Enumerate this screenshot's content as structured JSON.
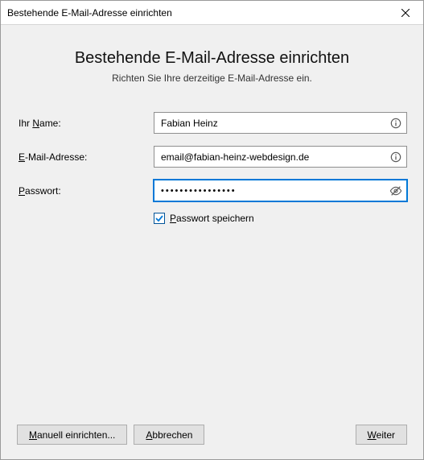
{
  "window": {
    "title": "Bestehende E-Mail-Adresse einrichten"
  },
  "header": {
    "title": "Bestehende E-Mail-Adresse einrichten",
    "subtitle": "Richten Sie Ihre derzeitige E-Mail-Adresse ein."
  },
  "form": {
    "name": {
      "label_pre": "Ihr ",
      "label_access": "N",
      "label_post": "ame:",
      "value": "Fabian Heinz"
    },
    "email": {
      "label_access": "E",
      "label_post": "-Mail-Adresse:",
      "value": "email@fabian-heinz-webdesign.de"
    },
    "password": {
      "label_access": "P",
      "label_post": "asswort:",
      "value": "••••••••••••••••"
    },
    "remember": {
      "label_access": "P",
      "label_post": "asswort speichern",
      "checked": true
    }
  },
  "buttons": {
    "manual": {
      "access": "M",
      "post": "anuell einrichten..."
    },
    "cancel": {
      "access": "A",
      "post": "bbrechen"
    },
    "next": {
      "access": "W",
      "post": "eiter"
    }
  }
}
